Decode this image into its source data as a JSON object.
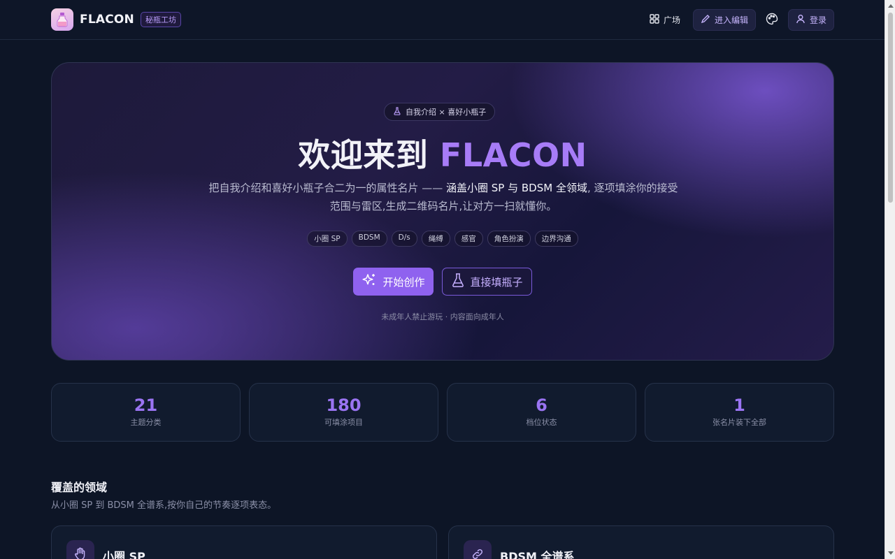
{
  "header": {
    "brand_name": "FLACON",
    "brand_badge": "秘瓶工坊",
    "nav_plaza": "广场",
    "nav_editor": "进入编辑",
    "nav_login": "登录"
  },
  "hero": {
    "tag": "自我介绍 × 喜好小瓶子",
    "title_prefix": "欢迎来到",
    "title_accent": "FLACON",
    "desc_part1": "把自我介绍和喜好小瓶子合二为一的属性名片 —— ",
    "desc_strong": "涵盖小圈 SP 与 BDSM 全领域",
    "desc_part2": ", 逐项填涂你的接受范围与雷区,生成二维码名片,让对方一扫就懂你。",
    "chips": [
      "小圈 SP",
      "BDSM",
      "D/s",
      "绳缚",
      "感官",
      "角色扮演",
      "边界沟通"
    ],
    "cta_primary": "开始创作",
    "cta_secondary": "直接填瓶子",
    "note": "未成年人禁止游玩 · 内容面向成年人"
  },
  "stats": [
    {
      "value": "21",
      "label": "主题分类"
    },
    {
      "value": "180",
      "label": "可填涂项目"
    },
    {
      "value": "6",
      "label": "档位状态"
    },
    {
      "value": "1",
      "label": "张名片装下全部"
    }
  ],
  "domains": {
    "title": "覆盖的领域",
    "subtitle": "从小圈 SP 到 BDSM 全谱系,按你自己的节奏逐项表态。",
    "cards": [
      {
        "title": "小圈 SP",
        "icon": "hand-icon"
      },
      {
        "title": "BDSM 全谱系",
        "icon": "link-icon"
      }
    ]
  },
  "colors": {
    "background": "#0d1526",
    "accent": "#9a74f2",
    "primary_button": "#8f62ef"
  }
}
